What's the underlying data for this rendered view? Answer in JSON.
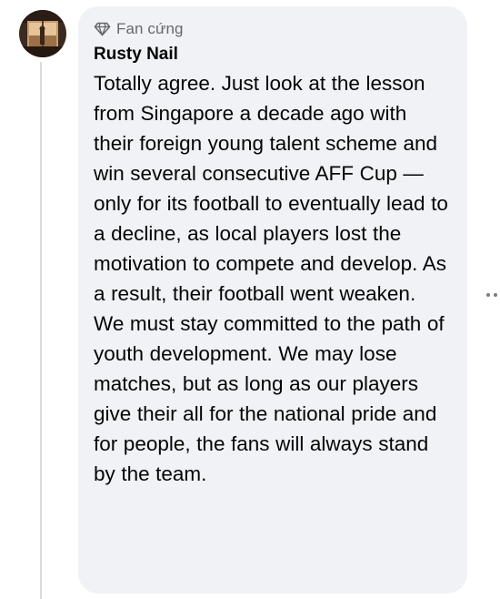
{
  "comment": {
    "badge": {
      "label": "Fan cứng",
      "icon": "diamond-icon"
    },
    "author": "Rusty Nail",
    "body": "Totally agree. Just look at the lesson from Singapore a decade ago with their foreign young talent scheme and win several consecutive AFF Cup — only for its football to eventually lead to a decline, as local players lost the motivation to compete and develop. As a result, their football went weaken. We must stay committed to the path of youth development. We may lose matches, but as long as our players give their all for the national pride and for people, the fans will always stand by the team.",
    "more_icon": "more-options-icon"
  },
  "colors": {
    "bubble": "#f0f2f5",
    "text": "#050505",
    "secondary_text": "#65676b",
    "thread_line": "#d8dadf"
  }
}
